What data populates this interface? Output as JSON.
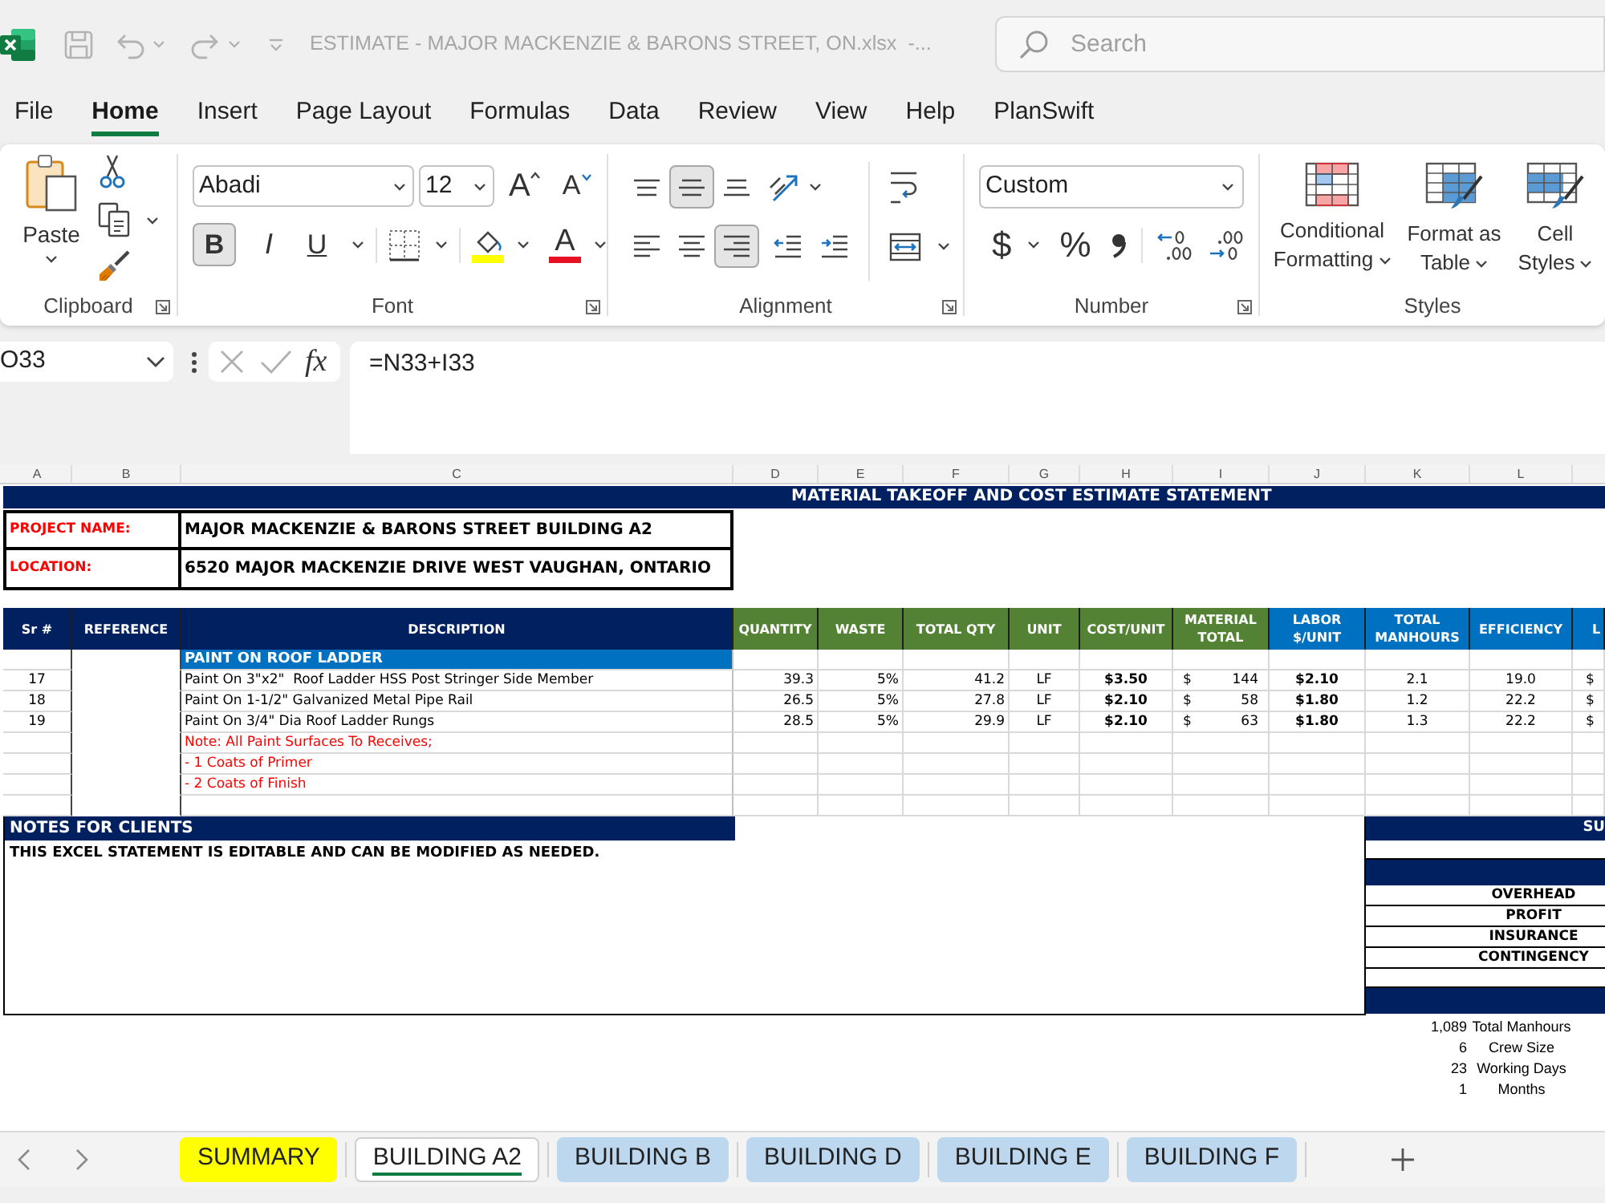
{
  "title_bar": {
    "title": "ESTIMATE - MAJOR MACKENZIE & BARONS STREET, ON.xlsx  -...",
    "search": {
      "placeholder": "Search"
    }
  },
  "menu_tabs": [
    {
      "label": "File",
      "selected": false
    },
    {
      "label": "Home",
      "selected": true
    },
    {
      "label": "Insert",
      "selected": false
    },
    {
      "label": "Page Layout",
      "selected": false
    },
    {
      "label": "Formulas",
      "selected": false
    },
    {
      "label": "Data",
      "selected": false
    },
    {
      "label": "Review",
      "selected": false
    },
    {
      "label": "View",
      "selected": false
    },
    {
      "label": "Help",
      "selected": false
    },
    {
      "label": "PlanSwift",
      "selected": false
    }
  ],
  "ribbon": {
    "clipboard": {
      "label": "Clipboard",
      "paste": "Paste"
    },
    "font": {
      "label": "Font",
      "font_name": "Abadi",
      "font_size": "12",
      "grow": "A",
      "shrink": "A",
      "font_color_letter": "A",
      "styles": [
        {
          "kind": "bold",
          "label": "B",
          "on": true
        },
        {
          "kind": "italic",
          "label": "I",
          "on": false
        },
        {
          "kind": "underline",
          "label": "U",
          "on": false
        }
      ]
    },
    "alignment": {
      "label": "Alignment",
      "vertical": [
        {
          "kind": "top",
          "selected": false
        },
        {
          "kind": "middle",
          "selected": true
        },
        {
          "kind": "bottom",
          "selected": false
        }
      ],
      "horizontal": [
        {
          "kind": "left",
          "selected": false
        },
        {
          "kind": "center",
          "selected": false
        },
        {
          "kind": "right",
          "selected": true
        }
      ]
    },
    "number": {
      "label": "Number",
      "format": "Custom",
      "currency": "$",
      "percent": "%"
    },
    "styles": {
      "label": "Styles",
      "buttons": [
        {
          "kind": "conditional",
          "label": "Conditional Formatting"
        },
        {
          "kind": "table",
          "label": "Format as Table"
        },
        {
          "kind": "cell",
          "label": "Cell Styles"
        }
      ]
    }
  },
  "formula_bar": {
    "name_box": "O33",
    "insert_function": "fx",
    "formula": "=N33+I33"
  },
  "sheet": {
    "column_letters": [
      "A",
      "B",
      "C",
      "D",
      "E",
      "F",
      "G",
      "H",
      "I",
      "J",
      "K",
      "L"
    ],
    "title": "MATERIAL TAKEOFF AND COST ESTIMATE STATEMENT",
    "project": [
      {
        "label": "PROJECT NAME:",
        "value": "MAJOR MACKENZIE & BARONS STREET BUILDING A2"
      },
      {
        "label": "LOCATION:",
        "value": "6520 MAJOR MACKENZIE DRIVE WEST VAUGHAN, ONTARIO"
      }
    ],
    "columns": [
      {
        "label": "Sr #",
        "color": "#002060"
      },
      {
        "label": "REFERENCE",
        "color": "#002060"
      },
      {
        "label": "DESCRIPTION",
        "color": "#002060"
      },
      {
        "label": "QUANTITY",
        "color": "#548235"
      },
      {
        "label": "WASTE",
        "color": "#548235"
      },
      {
        "label": "TOTAL QTY",
        "color": "#548235"
      },
      {
        "label": "UNIT",
        "color": "#548235"
      },
      {
        "label": "COST/UNIT",
        "color": "#548235"
      },
      {
        "label": "MATERIAL TOTAL",
        "color": "#548235"
      },
      {
        "label": "LABOR $/UNIT",
        "color": "#0070c0"
      },
      {
        "label": "TOTAL MANHOURS",
        "color": "#0070c0"
      },
      {
        "label": "EFFICIENCY",
        "color": "#0070c0"
      },
      {
        "label": "L",
        "color": "#0070c0"
      }
    ],
    "section": "PAINT ON ROOF LADDER",
    "rows": [
      {
        "sr": "17",
        "description": "Paint On 3\"x2\"  Roof Ladder HSS Post Stringer Side Member",
        "quantity": "39.3",
        "waste": "5%",
        "total_qty": "41.2",
        "unit": "LF",
        "cost_unit": "$3.50",
        "material_currency": "$",
        "material_total": "144",
        "labor_unit": "$2.10",
        "total_manhours": "2.1",
        "efficiency": "19.0",
        "column_13": "$"
      },
      {
        "sr": "18",
        "description": "Paint On 1-1/2\" Galvanized Metal Pipe Rail",
        "quantity": "26.5",
        "waste": "5%",
        "total_qty": "27.8",
        "unit": "LF",
        "cost_unit": "$2.10",
        "material_currency": "$",
        "material_total": "58",
        "labor_unit": "$1.80",
        "total_manhours": "1.2",
        "efficiency": "22.2",
        "column_13": "$"
      },
      {
        "sr": "19",
        "description": "Paint On 3/4\" Dia Roof Ladder Rungs",
        "quantity": "28.5",
        "waste": "5%",
        "total_qty": "29.9",
        "unit": "LF",
        "cost_unit": "$2.10",
        "material_currency": "$",
        "material_total": "63",
        "labor_unit": "$1.80",
        "total_manhours": "1.3",
        "efficiency": "22.2",
        "column_13": "$"
      }
    ],
    "notes": [
      "Note: All Paint Surfaces To Receives;",
      "- 1 Coats of Primer",
      "- 2 Coats of Finish"
    ],
    "notes_for_clients": {
      "title": "NOTES FOR CLIENTS",
      "text": "THIS EXCEL STATEMENT IS EDITABLE AND CAN BE MODIFIED AS NEEDED."
    },
    "summary": {
      "title": "SU",
      "rows": [
        {
          "kind": "blank"
        },
        {
          "kind": "band"
        },
        {
          "kind": "item",
          "label": "OVERHEAD"
        },
        {
          "kind": "item",
          "label": "PROFIT"
        },
        {
          "kind": "item",
          "label": "INSURANCE"
        },
        {
          "kind": "item",
          "label": "CONTINGENCY"
        },
        {
          "kind": "blank"
        },
        {
          "kind": "band"
        }
      ]
    },
    "crew_rows": [
      [
        "1,089",
        "Total Manhours"
      ],
      [
        "6",
        "Crew Size"
      ],
      [
        "23",
        "Working Days"
      ],
      [
        "1",
        "Months"
      ]
    ]
  },
  "sheet_tabs": [
    {
      "label": "SUMMARY",
      "selected": false,
      "color": "#ffff00"
    },
    {
      "label": "BUILDING A2",
      "selected": true
    },
    {
      "label": "BUILDING B",
      "selected": false,
      "color": "#bdd7ee"
    },
    {
      "label": "BUILDING D",
      "selected": false,
      "color": "#bdd7ee"
    },
    {
      "label": "BUILDING E",
      "selected": false,
      "color": "#bdd7ee"
    },
    {
      "label": "BUILDING F",
      "selected": false,
      "color": "#bdd7ee"
    }
  ]
}
